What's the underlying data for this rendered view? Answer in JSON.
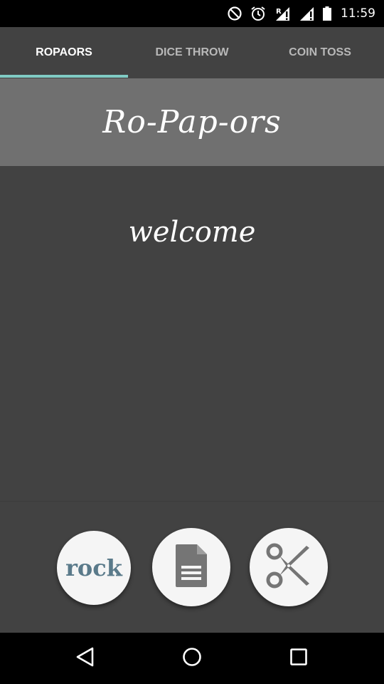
{
  "status_bar": {
    "time": "11:59",
    "icons": [
      "do-not-disturb-icon",
      "alarm-icon",
      "signal-roaming-icon",
      "signal-icon",
      "battery-icon"
    ]
  },
  "tabs": [
    {
      "label": "ROPAORS",
      "active": true
    },
    {
      "label": "DICE THROW",
      "active": false
    },
    {
      "label": "COIN TOSS",
      "active": false
    }
  ],
  "header": {
    "title": "Ro-Pap-ors"
  },
  "main": {
    "welcome": "welcome"
  },
  "choices": {
    "rock_label": "rock",
    "paper_icon": "document-icon",
    "scissors_icon": "scissors-icon"
  },
  "nav": {
    "icons": [
      "back-icon",
      "home-icon",
      "recents-icon"
    ]
  },
  "colors": {
    "accent": "#80cbc4",
    "title_band": "#707070",
    "background": "#424242",
    "rock_text": "#5a7a8a"
  }
}
